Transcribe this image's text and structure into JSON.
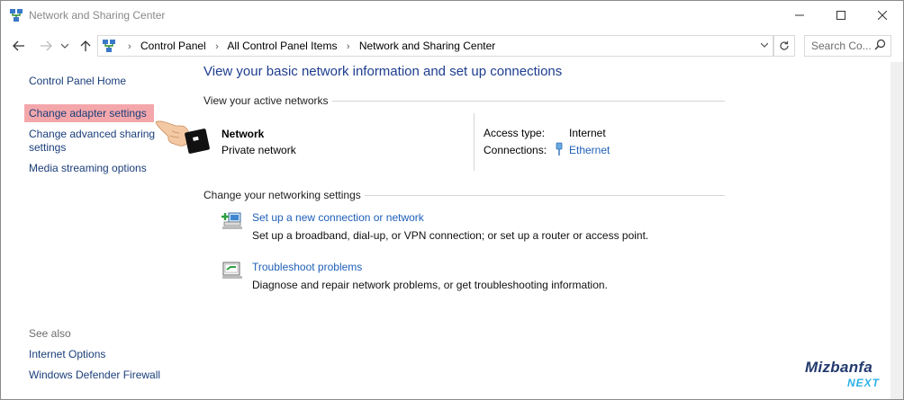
{
  "window": {
    "title": "Network and Sharing Center",
    "minimize_icon": "minimize-icon",
    "maximize_icon": "maximize-icon",
    "close_icon": "close-icon"
  },
  "address_bar": {
    "breadcrumbs": [
      "Control Panel",
      "All Control Panel Items",
      "Network and Sharing Center"
    ],
    "search_placeholder": "Search Co..."
  },
  "sidebar": {
    "items": [
      {
        "label": "Control Panel Home"
      },
      {
        "label": "Change adapter settings"
      },
      {
        "label": "Change advanced sharing settings"
      },
      {
        "label": "Media streaming options"
      }
    ],
    "see_also_title": "See also",
    "see_also": [
      {
        "label": "Internet Options"
      },
      {
        "label": "Windows Defender Firewall"
      }
    ]
  },
  "main": {
    "heading": "View your basic network information and set up connections",
    "active_networks_label": "View your active networks",
    "network": {
      "name": "Network",
      "type": "Private network",
      "access_type_label": "Access type:",
      "access_type_value": "Internet",
      "connections_label": "Connections:",
      "connections_value": "Ethernet"
    },
    "change_settings_label": "Change your networking settings",
    "actions": [
      {
        "title": "Set up a new connection or network",
        "desc": "Set up a broadband, dial-up, or VPN connection; or set up a router or access point."
      },
      {
        "title": "Troubleshoot problems",
        "desc": "Diagnose and repair network problems, or get troubleshooting information."
      }
    ]
  },
  "brand": {
    "name": "Mizbanfa",
    "tag": "NEXT"
  },
  "colors": {
    "link": "#003399",
    "heading": "#1e3d8f",
    "highlight": "#f4a7ab",
    "brand_dark": "#233a6e",
    "brand_light": "#2bb0e6"
  }
}
